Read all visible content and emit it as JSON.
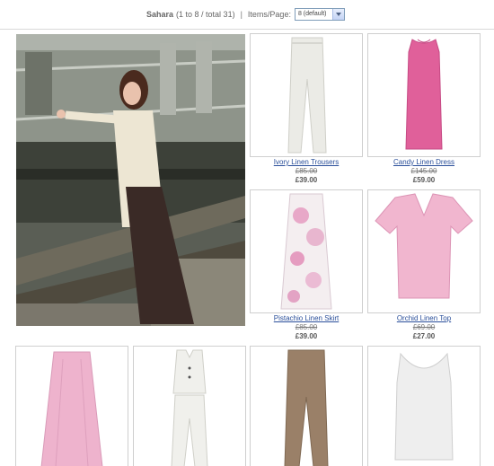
{
  "header": {
    "category": "Sahara",
    "count_text": "(1 to 8 / total 31)",
    "separator": "|",
    "items_per_page_label": "Items/Page:",
    "items_per_page_value": "8 (default)"
  },
  "products": [
    {
      "name": "Ivory Linen Trousers",
      "old_price": "£85.00",
      "price": "£39.00",
      "icon": "trousers-image",
      "color": "#ebebe6"
    },
    {
      "name": "Candy Linen Dress",
      "old_price": "£145.00",
      "price": "£59.00",
      "icon": "dress-image",
      "color": "#e0609a"
    },
    {
      "name": "Pistachio Linen Skirt",
      "old_price": "£85.00",
      "price": "£39.00",
      "icon": "skirt-image",
      "color": "#e8c6da"
    },
    {
      "name": "Orchid Linen Top",
      "old_price": "£69.00",
      "price": "£27.00",
      "icon": "top-image",
      "color": "#f1b6cf"
    },
    {
      "name": "",
      "icon": "pink-skirt-image",
      "color": "#eeb3cd"
    },
    {
      "name": "",
      "icon": "white-suit-image",
      "color": "#f0f0ec"
    },
    {
      "name": "",
      "icon": "brown-trousers-image",
      "color": "#9a8068"
    },
    {
      "name": "",
      "icon": "white-vest-image",
      "color": "#eeeeee"
    }
  ]
}
